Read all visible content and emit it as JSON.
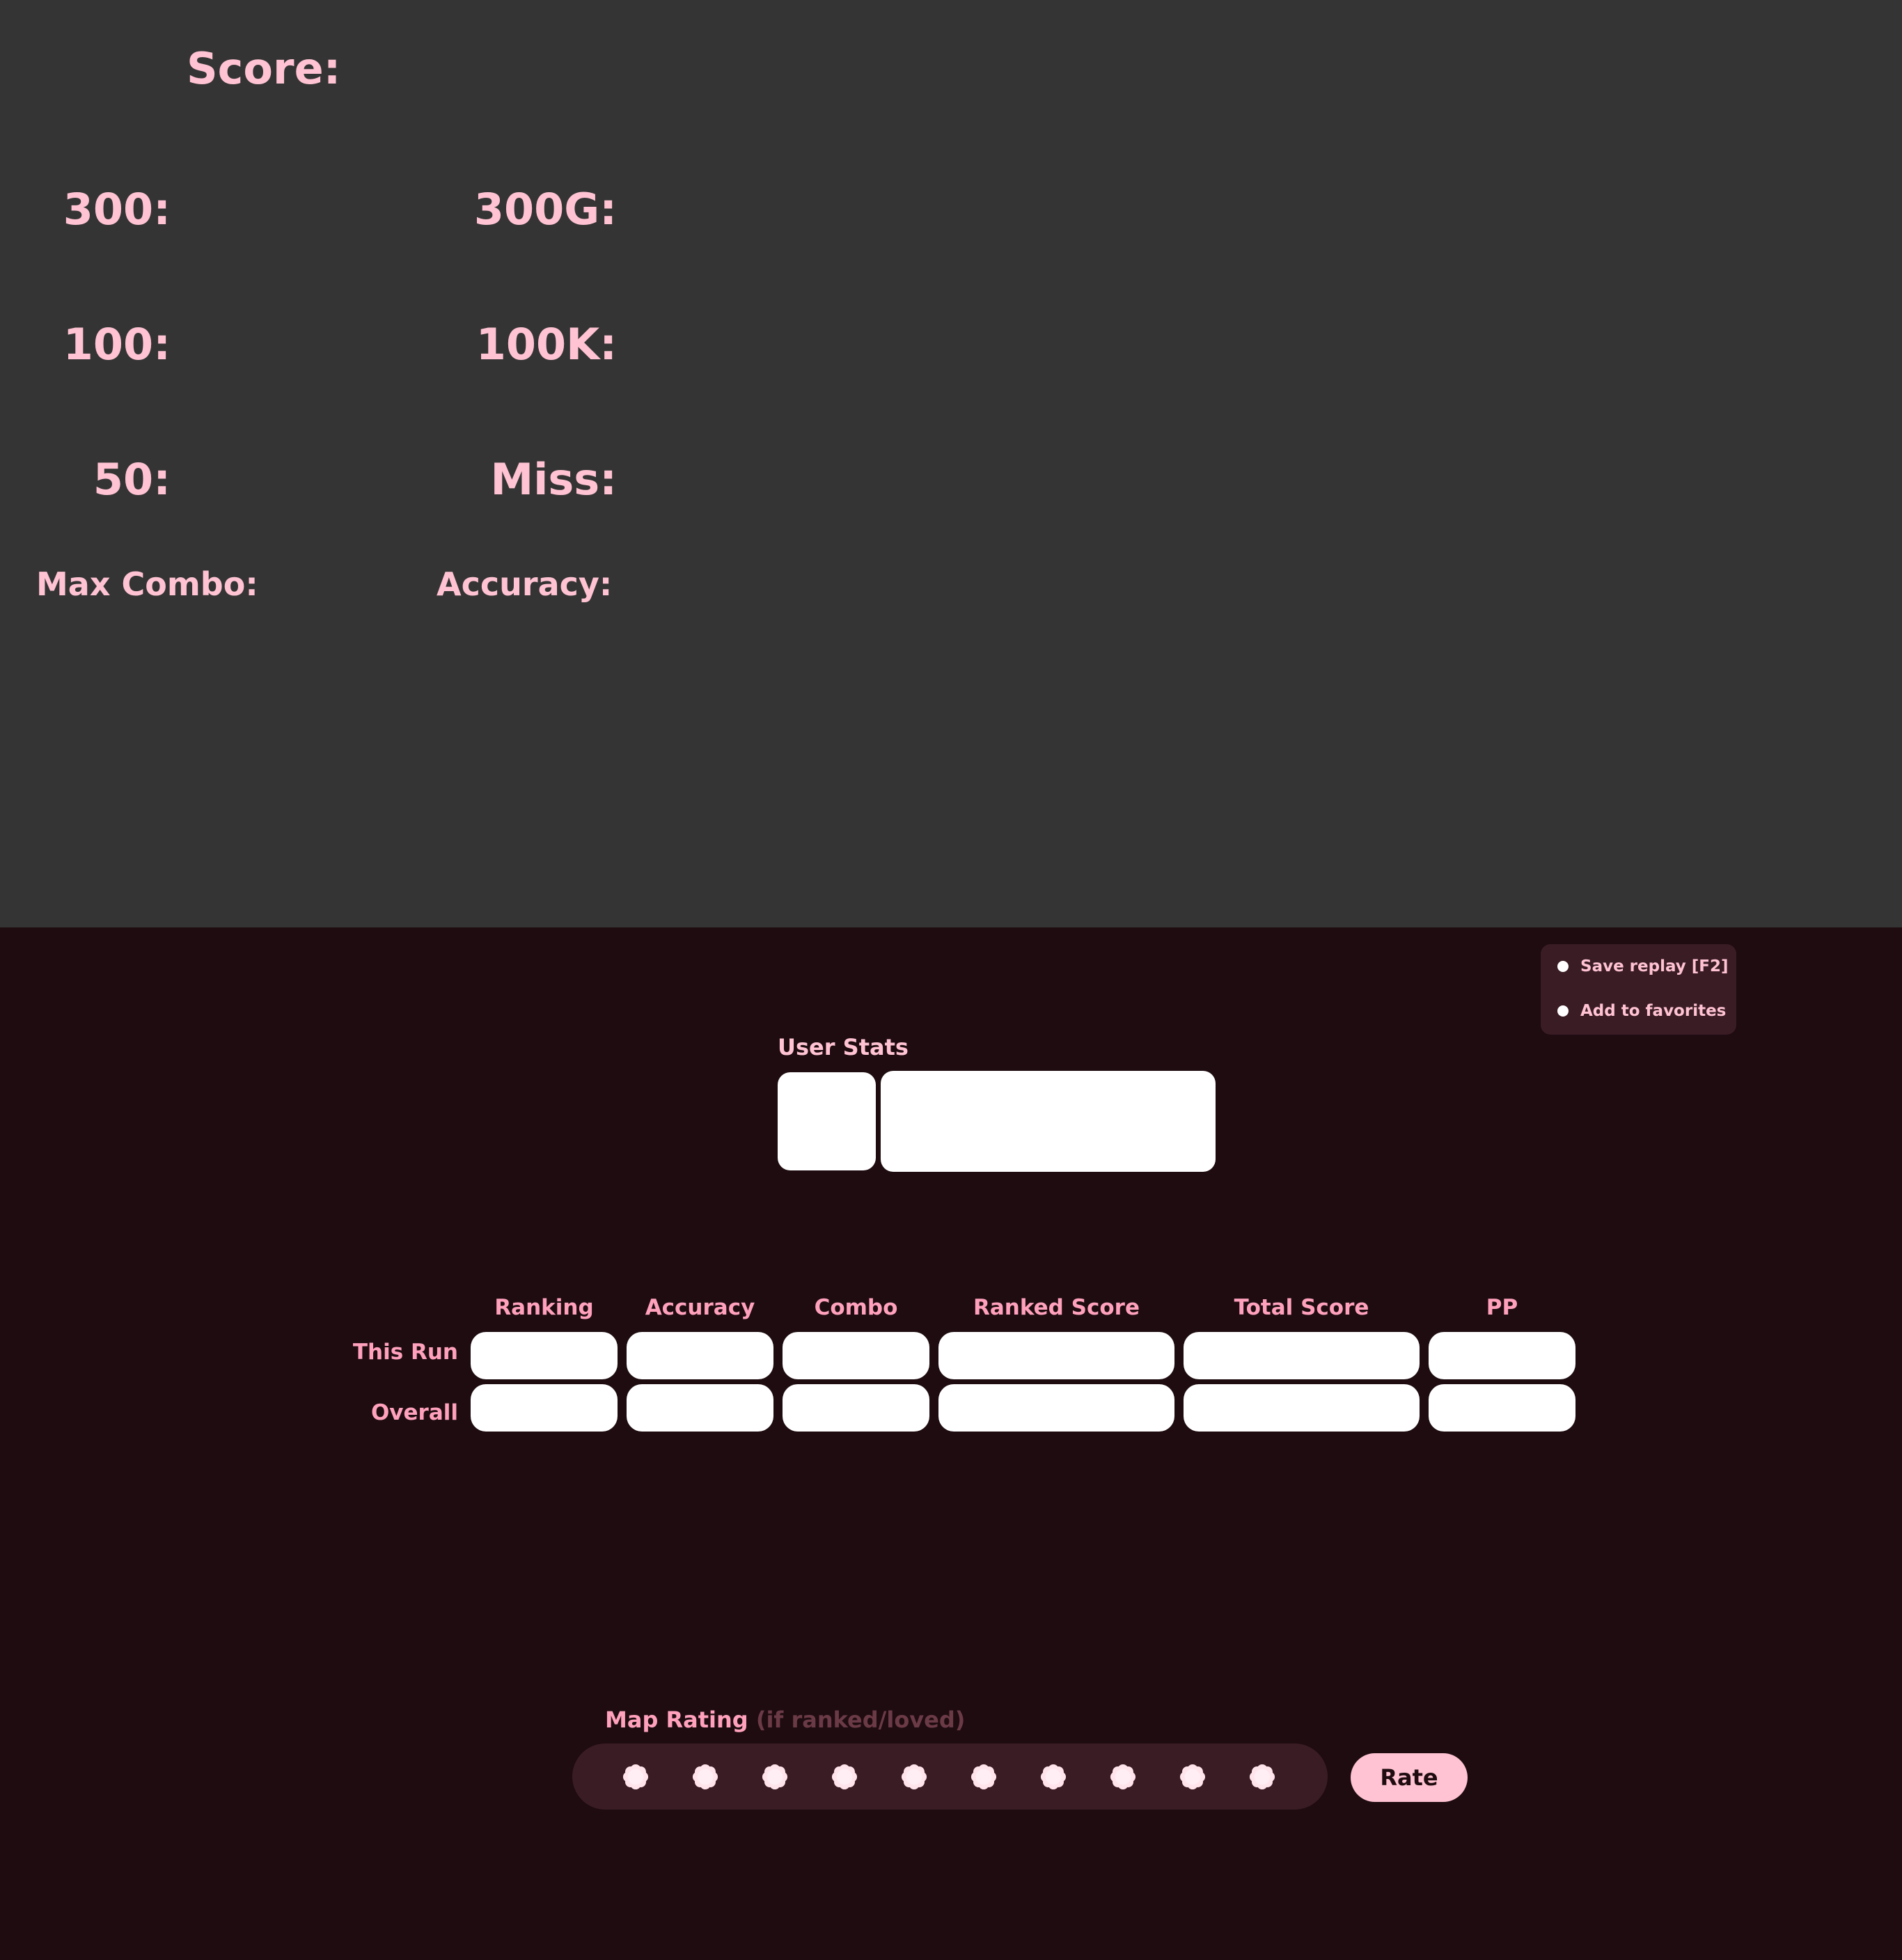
{
  "stats": {
    "score_label": "Score:",
    "hit300_label": "300:",
    "hit300g_label": "300G:",
    "hit100_label": "100:",
    "hit100k_label": "100K:",
    "hit50_label": "50:",
    "miss_label": "Miss:",
    "max_combo_label": "Max Combo:",
    "accuracy_label": "Accuracy:"
  },
  "menu": {
    "items": [
      {
        "label": "Save replay [F2]"
      },
      {
        "label": "Add to favorites"
      }
    ]
  },
  "user_stats": {
    "title": "User Stats"
  },
  "table": {
    "columns": [
      "Ranking",
      "Accuracy",
      "Combo",
      "Ranked Score",
      "Total Score",
      "PP"
    ],
    "rows": [
      "This Run",
      "Overall"
    ]
  },
  "rating": {
    "title": "Map Rating",
    "subtitle": "(if ranked/loved)",
    "star_count": 10,
    "button_label": "Rate"
  },
  "colors": {
    "top_panel": "#343434",
    "background": "#1e0c10",
    "accent_pink": "#ffc3d3",
    "header_pink": "#ffa1bd",
    "card": "#3a1c25"
  }
}
